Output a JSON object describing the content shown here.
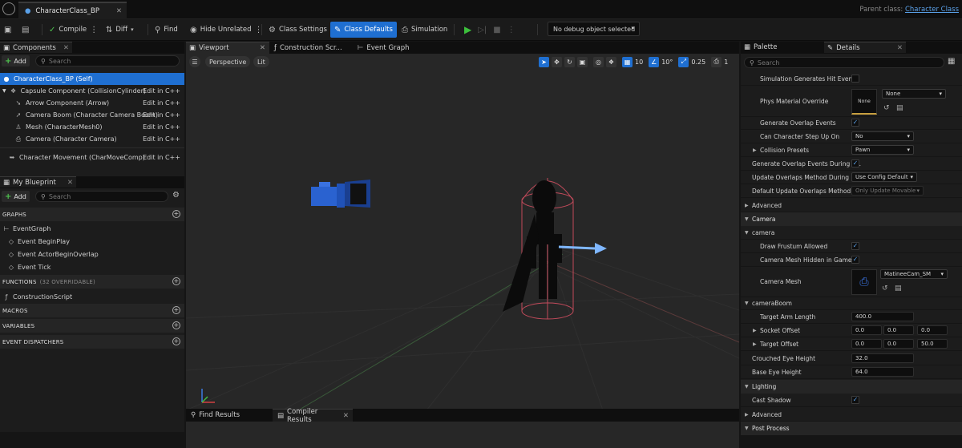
{
  "title_bar": {
    "tab_title": "CharacterClass_BP",
    "tab_close": "✕",
    "parent_label": "Parent class:",
    "parent_value": "Character Class"
  },
  "toolbar": {
    "compile": "Compile",
    "diff": "Diff",
    "find": "Find",
    "hide_unrelated": "Hide Unrelated",
    "class_settings": "Class Settings",
    "class_defaults": "Class Defaults",
    "simulation": "Simulation",
    "debug_select": "No debug object selected"
  },
  "components": {
    "tab": "Components",
    "add": "Add",
    "search_placeholder": "Search",
    "rows": [
      {
        "label": "CharacterClass_BP (Self)",
        "edit": ""
      },
      {
        "label": "Capsule Component (CollisionCylinder)",
        "edit": "Edit in C++"
      },
      {
        "label": "Arrow Component (Arrow)",
        "edit": "Edit in C++"
      },
      {
        "label": "Camera Boom (Character Camera Boom)",
        "edit": "Edit in C++"
      },
      {
        "label": "Mesh (CharacterMesh0)",
        "edit": "Edit in C++"
      },
      {
        "label": "Camera (Character Camera)",
        "edit": "Edit in C++"
      },
      {
        "label": "Character Movement (CharMoveComp)",
        "edit": "Edit in C++"
      }
    ]
  },
  "my_blueprint": {
    "tab": "My Blueprint",
    "add": "Add",
    "search_placeholder": "Search",
    "graphs": "GRAPHS",
    "event_graph": "EventGraph",
    "events": [
      "Event BeginPlay",
      "Event ActorBeginOverlap",
      "Event Tick"
    ],
    "functions": "FUNCTIONS",
    "functions_count": "(32 OVERRIDABLE)",
    "construction_script": "ConstructionScript",
    "macros": "MACROS",
    "variables": "VARIABLES",
    "event_dispatchers": "EVENT DISPATCHERS"
  },
  "center": {
    "tabs": [
      "Viewport",
      "Construction Scr...",
      "Event Graph"
    ],
    "perspective": "Perspective",
    "lit": "Lit",
    "grid_snap": "10",
    "rot_snap": "10°",
    "scale_snap": "0.25",
    "camera_speed": "1",
    "bottom_tabs": [
      "Find Results",
      "Compiler Results"
    ]
  },
  "details": {
    "tabs": [
      "Palette",
      "Details"
    ],
    "search_placeholder": "Search",
    "rows": {
      "sim_hit": "Simulation Generates Hit Events",
      "phys_mat": "Phys Material Override",
      "phys_mat_thumb": "None",
      "phys_mat_value": "None",
      "gen_overlap": "Generate Overlap Events",
      "step_up": "Can Character Step Up On",
      "step_up_value": "No",
      "coll_presets": "Collision Presets",
      "coll_presets_value": "Pawn",
      "gen_overlap_level": "Generate Overlap Events During L...",
      "update_overlaps": "Update Overlaps Method During L...",
      "update_overlaps_value": "Use Config Default",
      "default_update": "Default Update Overlaps Method...",
      "default_update_value": "Only Update Movable",
      "advanced1": "Advanced",
      "camera_cat": "Camera",
      "camera_sub": "camera",
      "draw_frustum": "Draw Frustum Allowed",
      "cam_mesh_hidden": "Camera Mesh Hidden in Game",
      "cam_mesh": "Camera Mesh",
      "cam_mesh_value": "MatineeCam_SM",
      "camera_boom": "cameraBoom",
      "arm_length": "Target Arm Length",
      "arm_length_value": "400.0",
      "socket_offset": "Socket Offset",
      "socket_offset_values": [
        "0.0",
        "0.0",
        "0.0"
      ],
      "target_offset": "Target Offset",
      "target_offset_values": [
        "0.0",
        "0.0",
        "50.0"
      ],
      "crouched_eye": "Crouched Eye Height",
      "crouched_eye_value": "32.0",
      "base_eye": "Base Eye Height",
      "base_eye_value": "64.0",
      "lighting": "Lighting",
      "cast_shadow": "Cast Shadow",
      "advanced2": "Advanced",
      "post_process": "Post Process"
    }
  }
}
